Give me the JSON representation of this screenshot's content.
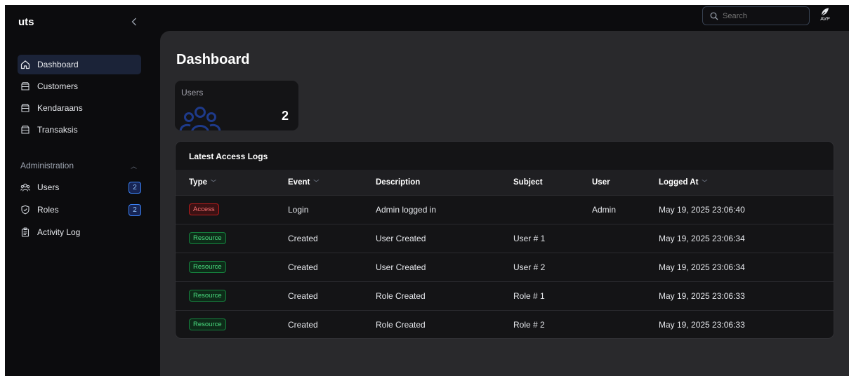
{
  "brand": "uts",
  "nav": {
    "main_items": [
      {
        "label": "Dashboard",
        "icon": "home-icon",
        "active": true
      },
      {
        "label": "Customers",
        "icon": "box-icon"
      },
      {
        "label": "Kendaraans",
        "icon": "box-icon"
      },
      {
        "label": "Transaksis",
        "icon": "box-icon"
      }
    ],
    "group_label": "Administration",
    "admin_items": [
      {
        "label": "Users",
        "icon": "users-icon",
        "badge": "2"
      },
      {
        "label": "Roles",
        "icon": "shield-icon",
        "badge": "2"
      },
      {
        "label": "Activity Log",
        "icon": "clipboard-icon"
      }
    ]
  },
  "search": {
    "placeholder": "Search"
  },
  "avatar": {
    "initials": "AVP"
  },
  "page": {
    "title": "Dashboard"
  },
  "stat": {
    "label": "Users",
    "value": "2"
  },
  "logs": {
    "title": "Latest Access Logs",
    "columns": [
      "Type",
      "Event",
      "Description",
      "Subject",
      "User",
      "Logged At"
    ],
    "rows": [
      {
        "type": "Access",
        "event": "Login",
        "description": "Admin logged in",
        "subject": "",
        "user": "Admin",
        "logged_at": "May 19, 2025 23:06:40"
      },
      {
        "type": "Resource",
        "event": "Created",
        "description": "User Created",
        "subject": "User # 1",
        "user": "",
        "logged_at": "May 19, 2025 23:06:34"
      },
      {
        "type": "Resource",
        "event": "Created",
        "description": "User Created",
        "subject": "User # 2",
        "user": "",
        "logged_at": "May 19, 2025 23:06:34"
      },
      {
        "type": "Resource",
        "event": "Created",
        "description": "Role Created",
        "subject": "Role # 1",
        "user": "",
        "logged_at": "May 19, 2025 23:06:33"
      },
      {
        "type": "Resource",
        "event": "Created",
        "description": "Role Created",
        "subject": "Role # 2",
        "user": "",
        "logged_at": "May 19, 2025 23:06:33"
      }
    ]
  },
  "colors": {
    "accent": "#3b82f6",
    "access_tag": "#f87171",
    "resource_tag": "#4ade80"
  }
}
